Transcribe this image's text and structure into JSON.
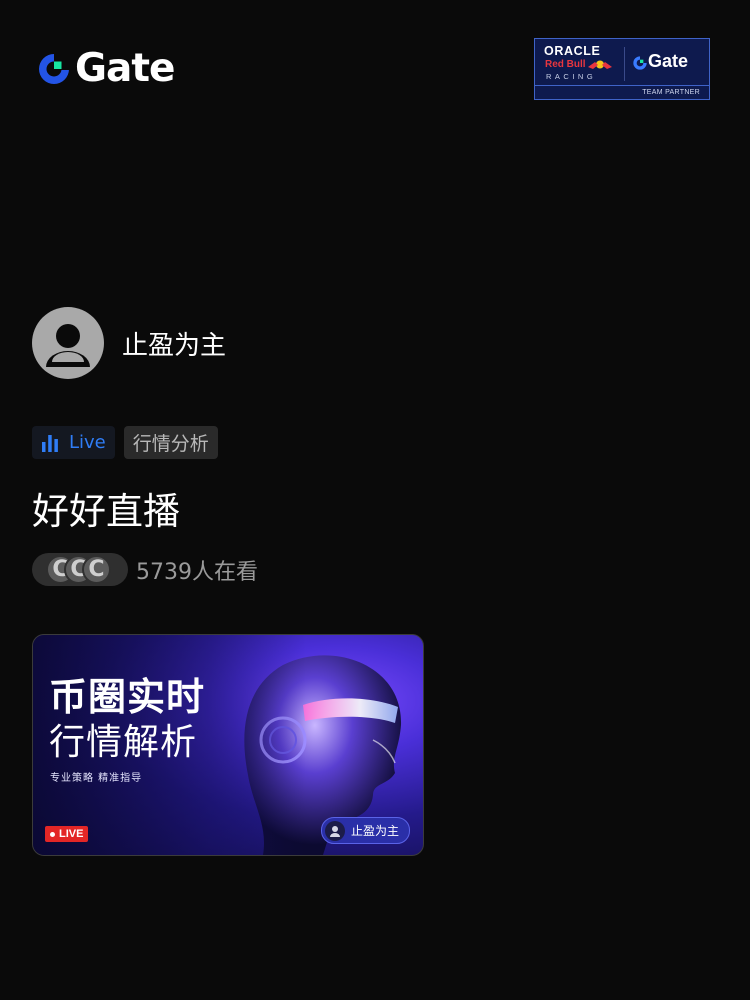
{
  "brand": {
    "logo_text": "Gate",
    "logo_icon": "gate-logo-icon",
    "accent_blue": "#2354e6",
    "accent_green": "#17e6a1"
  },
  "partner_badge": {
    "oracle": "ORACLE",
    "redbull": "Red Bull",
    "racing": "RACING",
    "gate": "Gate",
    "team_partner": "TEAM PARTNER"
  },
  "host": {
    "name": "止盈为主",
    "avatar_icon": "default-avatar-icon"
  },
  "tags": {
    "live_label": "Live",
    "live_icon": "bar-chart-icon",
    "category": "行情分析",
    "live_color": "#2f7df6"
  },
  "stream": {
    "title": "好好直播",
    "viewer_count_text": "5739人在看",
    "viewer_avatar_glyph": "C"
  },
  "thumbnail": {
    "headline_1": "币圈实时",
    "headline_2": "行情解析",
    "subline": "专业策略  精准指导",
    "live_badge": "LIVE",
    "host_chip": "止盈为主",
    "live_badge_color": "#e32626"
  }
}
